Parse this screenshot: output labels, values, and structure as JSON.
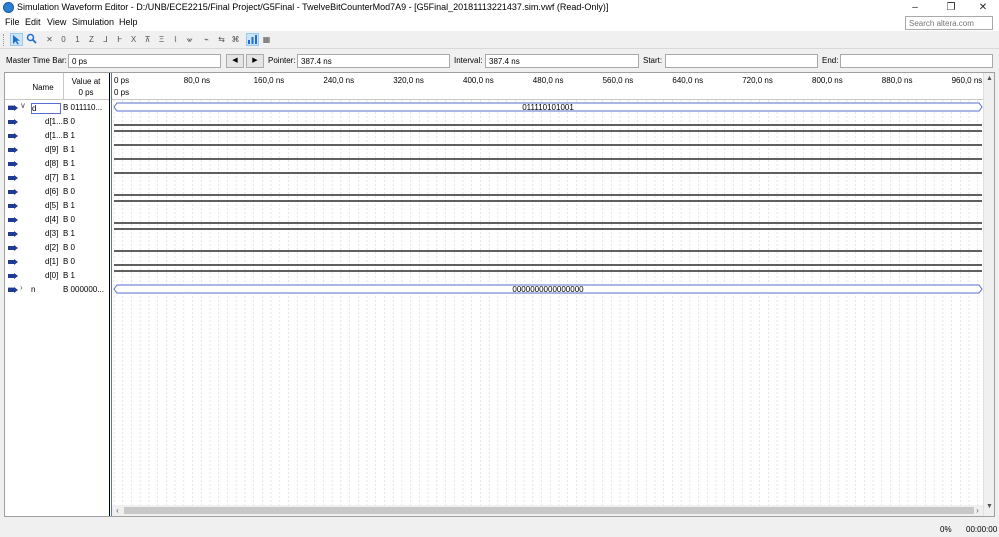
{
  "window": {
    "title": "Simulation Waveform Editor - D:/UNB/ECE2215/Final Project/G5Final - TwelveBitCounterMod7A9 - [G5Final_20181113221437.sim.vwf (Read-Only)]",
    "minimize": "–",
    "maximize": "❐",
    "close": "✕"
  },
  "menu": {
    "items": [
      "File",
      "Edit",
      "View",
      "Simulation",
      "Help"
    ],
    "search_placeholder": "Search altera.com"
  },
  "toolbar": {
    "buttons": [
      "pointer-icon",
      "zoom-icon",
      "waveform-x-icon",
      "waveform-0-icon",
      "waveform-1-icon",
      "waveform-z-icon",
      "waveform-l-icon",
      "waveform-h-icon",
      "waveform-dc-icon",
      "invert-icon",
      "count-value-icon",
      "clock-icon",
      "random-icon",
      "arbitrary-icon",
      "snap-icon",
      "grid-icon",
      "bus-icon",
      "overwrite-icon"
    ]
  },
  "timebar": {
    "master_label": "Master Time Bar:",
    "master_value": "0 ps",
    "prev": "◀",
    "next": "▶",
    "pointer_label": "Pointer:",
    "pointer_value": "387.4 ns",
    "interval_label": "Interval:",
    "interval_value": "387.4 ns",
    "start_label": "Start:",
    "start_value": "",
    "end_label": "End:",
    "end_value": ""
  },
  "table": {
    "name_header": "Name",
    "value_header_1": "Value at",
    "value_header_2": "0 ps",
    "ruler_origin": "0 ps",
    "ruler_labels": [
      "0 ps",
      "80,0 ns",
      "160,0 ns",
      "240,0 ns",
      "320,0 ns",
      "400,0 ns",
      "480,0 ns",
      "560,0 ns",
      "640,0 ns",
      "720,0 ns",
      "800,0 ns",
      "880,0 ns",
      "960,0 ns"
    ],
    "signals": [
      {
        "name": "d",
        "value": "B 011110...",
        "bus": true,
        "expander": "∨",
        "bus_value": "011110101001"
      },
      {
        "name": "d[1...",
        "value": "B 0",
        "level": 0
      },
      {
        "name": "d[1...",
        "value": "B 1",
        "level": 1
      },
      {
        "name": "d[9]",
        "value": "B 1",
        "level": 1
      },
      {
        "name": "d[8]",
        "value": "B 1",
        "level": 1
      },
      {
        "name": "d[7]",
        "value": "B 1",
        "level": 1
      },
      {
        "name": "d[6]",
        "value": "B 0",
        "level": 0
      },
      {
        "name": "d[5]",
        "value": "B 1",
        "level": 1
      },
      {
        "name": "d[4]",
        "value": "B 0",
        "level": 0
      },
      {
        "name": "d[3]",
        "value": "B 1",
        "level": 1
      },
      {
        "name": "d[2]",
        "value": "B 0",
        "level": 0
      },
      {
        "name": "d[1]",
        "value": "B 0",
        "level": 0
      },
      {
        "name": "d[0]",
        "value": "B 1",
        "level": 1
      },
      {
        "name": "n",
        "value": "B 000000...",
        "bus": true,
        "expander": "›",
        "bus_value": "0000000000000000"
      }
    ]
  },
  "scroll": {
    "left": "‹",
    "right": "›",
    "up": "▲",
    "down": "▼"
  },
  "status": {
    "progress": "0%",
    "time": "00:00:00"
  },
  "colors": {
    "bus_outline": "#5a6fcf",
    "selection": "#cce4f7",
    "pin_icon": "#1f3a93"
  }
}
